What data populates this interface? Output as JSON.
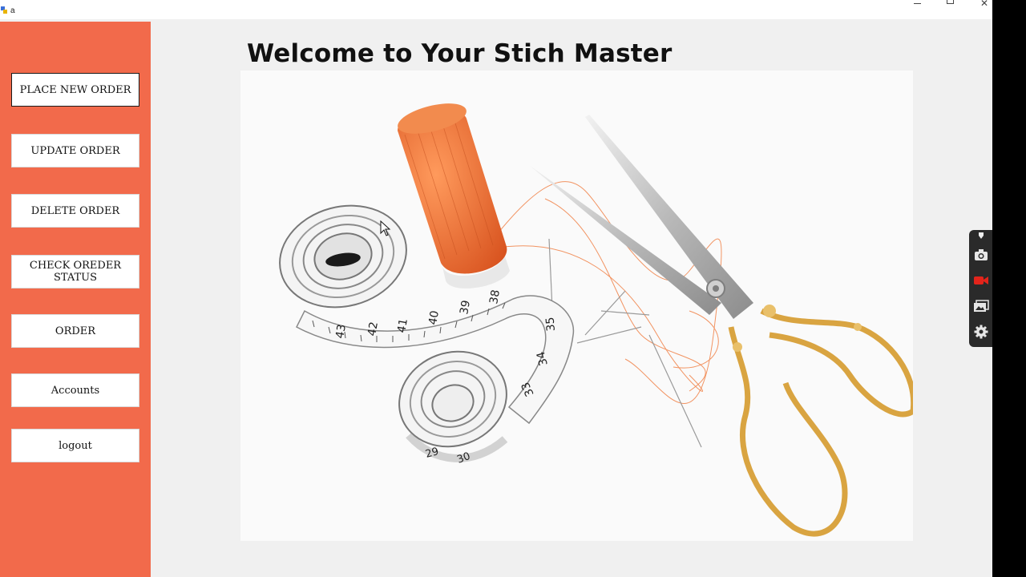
{
  "window": {
    "title": "a"
  },
  "sidebar": {
    "buttons": [
      {
        "label": "PLACE NEW ORDER"
      },
      {
        "label": "UPDATE ORDER"
      },
      {
        "label": "DELETE ORDER"
      },
      {
        "label": "CHECK OREDER STATUS"
      },
      {
        "label": "ORDER"
      },
      {
        "label": "Accounts"
      },
      {
        "label": "logout"
      }
    ]
  },
  "main": {
    "title": "Welcome to Your Stich Master"
  },
  "tape_numbers": [
    "43",
    "42",
    "41",
    "40",
    "39",
    "38",
    "35",
    "34",
    "33",
    "29",
    "30"
  ],
  "colors": {
    "sidebar": "#f26a4b",
    "accent": "#f26a4b",
    "thread": "#f07a3c",
    "scissor_gold": "#d9a441"
  },
  "icons": [
    "app-icon",
    "minimize-icon",
    "maximize-icon",
    "close-icon",
    "pin-icon",
    "camera-icon",
    "video-icon",
    "gallery-icon",
    "settings-icon"
  ]
}
